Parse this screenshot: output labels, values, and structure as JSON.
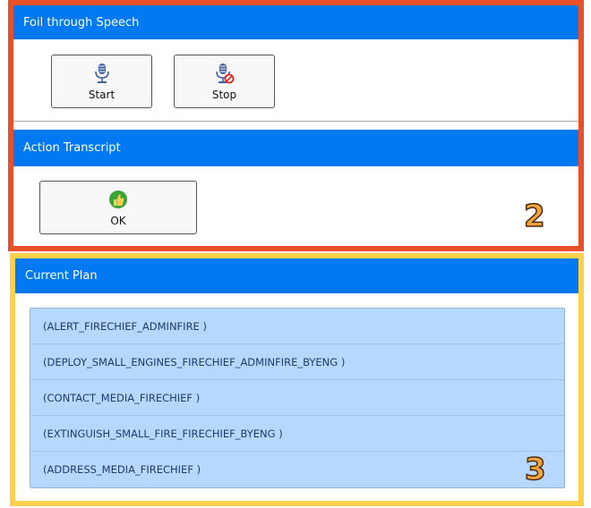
{
  "foil_panel": {
    "title": "Foil through Speech",
    "start_label": "Start",
    "stop_label": "Stop"
  },
  "action_panel": {
    "title": "Action Transcript",
    "ok_label": "OK"
  },
  "plan_panel": {
    "title": "Current Plan",
    "items": [
      "(ALERT_FIRECHIEF_ADMINFIRE )",
      "(DEPLOY_SMALL_ENGINES_FIRECHIEF_ADMINFIRE_BYENG )",
      "(CONTACT_MEDIA_FIRECHIEF )",
      "(EXTINGUISH_SMALL_FIRE_FIRECHIEF_BYENG )",
      "(ADDRESS_MEDIA_FIRECHIEF )"
    ]
  },
  "annotations": {
    "region_2": "2",
    "region_3": "3"
  },
  "colors": {
    "header_blue": "#0079f2",
    "region_2_border": "#e8502a",
    "region_3_border": "#fdd14a",
    "plan_item_bg": "#b7d8fd",
    "ok_icon_green": "#3aa335"
  },
  "icons": {
    "start": "microphone-icon",
    "stop": "microphone-stop-icon",
    "ok": "thumbs-up-icon"
  }
}
